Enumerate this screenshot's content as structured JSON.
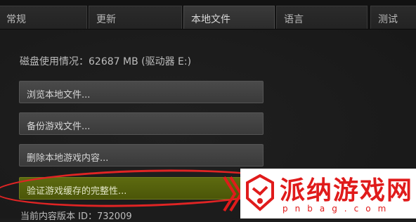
{
  "tabs": [
    {
      "label": "常规"
    },
    {
      "label": "更新"
    },
    {
      "label": "本地文件",
      "active": true
    },
    {
      "label": "语言"
    },
    {
      "label": "测试"
    }
  ],
  "disk_usage": "磁盘使用情况：62687 MB (驱动器 E:)",
  "buttons": {
    "browse_local": "浏览本地文件...",
    "backup_game": "备份游戏文件...",
    "delete_local": "删除本地游戏内容...",
    "verify_integrity": "验证游戏缓存的完整性..."
  },
  "version_line": "当前内容版本 ID：732009",
  "watermark": {
    "title": "派纳游戏网",
    "domain": "pnbag.com"
  },
  "colors": {
    "highlight_ring": "#e02424",
    "verify_button": "#5d6a10",
    "watermark": "#e01b1b"
  }
}
